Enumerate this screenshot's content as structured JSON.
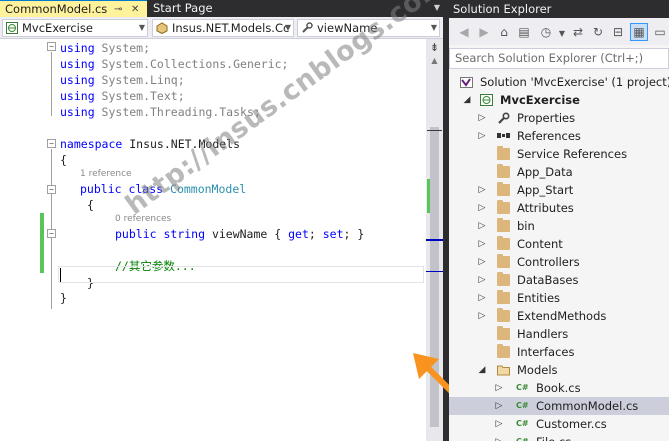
{
  "editor": {
    "tabs": [
      {
        "label": "CommonModel.cs",
        "active": true
      },
      {
        "label": "Start Page",
        "active": false
      }
    ],
    "nav": {
      "project": "MvcExercise",
      "type": "Insus.NET.Models.Cc",
      "member": "viewName"
    },
    "code": {
      "using1_kw": "using",
      "using1_ns": " System;",
      "using2_kw": "using",
      "using2_ns": " System.Collections.Generic;",
      "using3_kw": "using",
      "using3_ns": " System.Linq;",
      "using4_kw": "using",
      "using4_ns": " System.Text;",
      "using5_kw": "using",
      "using5_ns": " System.Threading.Tasks;",
      "ns_kw": "namespace",
      "ns_name": " Insus.NET.Models",
      "brace_open": "{",
      "class_refs": "1 reference",
      "class_mods": "public class ",
      "class_name": "CommonModel",
      "class_brace_open": "{",
      "prop_refs": "0 references",
      "prop_kw1": "public ",
      "prop_kw2": "string",
      "prop_rest": " viewName { ",
      "prop_get": "get",
      "prop_mid": "; ",
      "prop_set": "set",
      "prop_end": "; }",
      "comment": "//其它参数...",
      "class_brace_close": "}",
      "brace_close": "}"
    }
  },
  "watermark": "http://insus.cnblogs.com",
  "solution_explorer": {
    "title": "Solution Explorer",
    "search_placeholder": "Search Solution Explorer (Ctrl+;)",
    "tree": [
      {
        "label": "Solution 'MvcExercise' (1 project)",
        "icon": "solution-icon",
        "expander": "",
        "level": 0
      },
      {
        "label": "MvcExercise",
        "icon": "web-project-icon",
        "expander": "expanded",
        "level": 0,
        "bold": true
      },
      {
        "label": "Properties",
        "icon": "wrench-icon",
        "expander": "collapsed",
        "level": 1
      },
      {
        "label": "References",
        "icon": "references-icon",
        "expander": "collapsed",
        "level": 1
      },
      {
        "label": "Service References",
        "icon": "folder-icon",
        "expander": "",
        "level": 1
      },
      {
        "label": "App_Data",
        "icon": "folder-icon",
        "expander": "",
        "level": 1
      },
      {
        "label": "App_Start",
        "icon": "folder-icon",
        "expander": "collapsed",
        "level": 1
      },
      {
        "label": "Attributes",
        "icon": "folder-icon",
        "expander": "collapsed",
        "level": 1
      },
      {
        "label": "bin",
        "icon": "folder-icon",
        "expander": "collapsed",
        "level": 1
      },
      {
        "label": "Content",
        "icon": "folder-icon",
        "expander": "collapsed",
        "level": 1
      },
      {
        "label": "Controllers",
        "icon": "folder-icon",
        "expander": "collapsed",
        "level": 1
      },
      {
        "label": "DataBases",
        "icon": "folder-icon",
        "expander": "collapsed",
        "level": 1
      },
      {
        "label": "Entities",
        "icon": "folder-icon",
        "expander": "collapsed",
        "level": 1
      },
      {
        "label": "ExtendMethods",
        "icon": "folder-icon",
        "expander": "collapsed",
        "level": 1
      },
      {
        "label": "Handlers",
        "icon": "folder-icon",
        "expander": "",
        "level": 1
      },
      {
        "label": "Interfaces",
        "icon": "folder-icon",
        "expander": "",
        "level": 1
      },
      {
        "label": "Models",
        "icon": "folder-open-icon",
        "expander": "expanded",
        "level": 1
      },
      {
        "label": "Book.cs",
        "icon": "csharp-file-icon",
        "expander": "collapsed",
        "level": 2
      },
      {
        "label": "CommonModel.cs",
        "icon": "csharp-file-icon",
        "expander": "collapsed",
        "level": 2,
        "selected": true
      },
      {
        "label": "Customer.cs",
        "icon": "csharp-file-icon",
        "expander": "collapsed",
        "level": 2
      },
      {
        "label": "File.cs",
        "icon": "csharp-file-icon",
        "expander": "collapsed",
        "level": 2
      }
    ]
  },
  "colors": {
    "keyword": "#0000ff",
    "type": "#2b91af",
    "comment": "#008000",
    "active_tab": "#fff29d",
    "chrome_dark": "#2d2d30",
    "arrow": "#f7931e",
    "change_bar": "#57c557"
  }
}
